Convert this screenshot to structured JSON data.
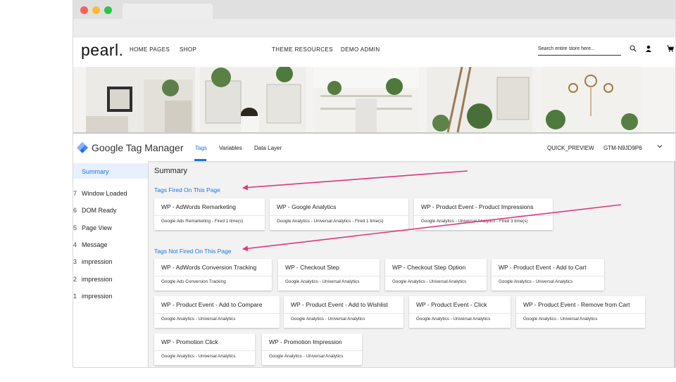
{
  "site": {
    "logo": "pearl.",
    "nav": [
      "HOME PAGES",
      "SHOP",
      "THEME RESOURCES",
      "DEMO ADMIN"
    ],
    "search_placeholder": "Search entire store here...",
    "search_icon": "search-icon",
    "account_icon": "user-icon",
    "cart_icon": "cart-icon"
  },
  "window_controls": {
    "close": "#fc5f57",
    "minimize": "#fdbc2e",
    "maximize": "#28c840"
  },
  "gtm": {
    "title": "Google Tag Manager",
    "tabs": [
      "Tags",
      "Variables",
      "Data Layer"
    ],
    "active_tab": "Tags",
    "quick_preview": "QUICK_PREVIEW",
    "container_id": "GTM-N9JD9P6",
    "accent": "#1a73e8"
  },
  "sidebar": {
    "summary": "Summary",
    "events": [
      {
        "num": "7",
        "label": "Window Loaded"
      },
      {
        "num": "6",
        "label": "DOM Ready"
      },
      {
        "num": "5",
        "label": "Page View"
      },
      {
        "num": "4",
        "label": "Message"
      },
      {
        "num": "3",
        "label": "impression"
      },
      {
        "num": "2",
        "label": "impression"
      },
      {
        "num": "1",
        "label": "impression"
      }
    ]
  },
  "main": {
    "title": "Summary",
    "fired_title": "Tags Fired On This Page",
    "not_fired_title": "Tags Not Fired On This Page",
    "fired": [
      {
        "title": "WP - AdWords Remarketing",
        "sub": "Google Ads Remarketing - Fired 1 time(s)"
      },
      {
        "title": "WP - Google Analytics",
        "sub": "Google Analytics - Universal Analytics - Fired 1 time(s)"
      },
      {
        "title": "WP - Product Event - Product Impressions",
        "sub": "Google Analytics - Universal Analytics - Fired 3 time(s)"
      }
    ],
    "not_fired": [
      {
        "title": "WP - AdWords Conversion Tracking",
        "sub": "Google Ads Conversion Tracking"
      },
      {
        "title": "WP - Checkout Step",
        "sub": "Google Analytics - Universal Analytics"
      },
      {
        "title": "WP - Checkout Step Option",
        "sub": "Google Analytics - Universal Analytics"
      },
      {
        "title": "WP - Product Event - Add to Cart",
        "sub": "Google Analytics - Universal Analytics"
      },
      {
        "title": "WP - Product Event - Add to Compare",
        "sub": "Google Analytics - Universal Analytics"
      },
      {
        "title": "WP - Product Event - Add to Wishlist",
        "sub": "Google Analytics - Universal Analytics"
      },
      {
        "title": "WP - Product Event - Click",
        "sub": "Google Analytics - Universal Analytics"
      },
      {
        "title": "WP - Product Event - Remove from Cart",
        "sub": "Google Analytics - Universal Analytics"
      },
      {
        "title": "WP - Promotion Click",
        "sub": "Google Analytics - Universal Analytics"
      },
      {
        "title": "WP - Promotion Impression",
        "sub": "Google Analytics - Universal Analytics"
      }
    ]
  },
  "annotation_color": "#e0367a"
}
